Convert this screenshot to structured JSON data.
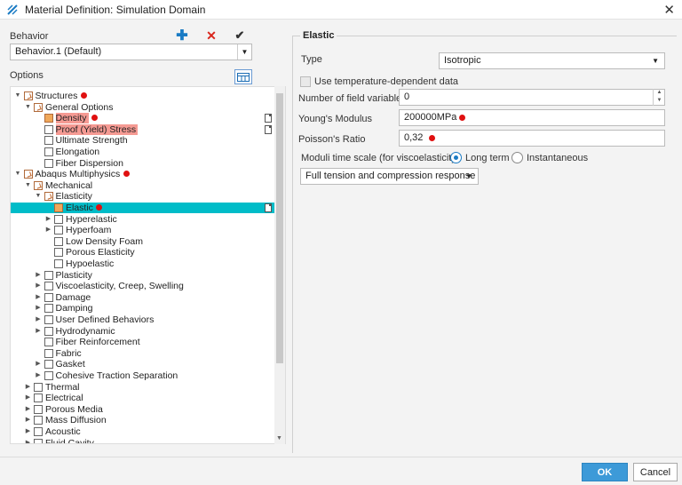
{
  "window": {
    "title": "Material Definition: Simulation Domain",
    "close_glyph": "✕"
  },
  "behavior": {
    "label": "Behavior",
    "selected": "Behavior.1 (Default)",
    "add_glyph": "✚",
    "delete_glyph": "✕",
    "confirm_glyph": "✔"
  },
  "options": {
    "label": "Options",
    "tree": [
      {
        "label": "Structures",
        "expander": "▼",
        "mod": true,
        "dot": true
      },
      {
        "label": "General Options",
        "expander": "▼",
        "mod": true
      },
      {
        "label": "Density",
        "checked": true,
        "highlight": true,
        "dot": true,
        "doc": true
      },
      {
        "label": "Proof (Yield) Stress",
        "highlight": true,
        "doc": true
      },
      {
        "label": "Ultimate Strength"
      },
      {
        "label": "Elongation"
      },
      {
        "label": "Fiber Dispersion"
      },
      {
        "label": "Abaqus Multiphysics",
        "expander": "▼",
        "mod": true,
        "dot": true
      },
      {
        "label": "Mechanical",
        "expander": "▼",
        "mod": true
      },
      {
        "label": "Elasticity",
        "expander": "▼",
        "mod": true
      },
      {
        "label": "Elastic",
        "checked": true,
        "selected": true,
        "dot": true,
        "doc": true
      },
      {
        "label": "Hyperelastic",
        "expander": "▶"
      },
      {
        "label": "Hyperfoam",
        "expander": "▶"
      },
      {
        "label": "Low Density Foam"
      },
      {
        "label": "Porous Elasticity"
      },
      {
        "label": "Hypoelastic"
      },
      {
        "label": "Plasticity",
        "expander": "▶"
      },
      {
        "label": "Viscoelasticity, Creep, Swelling",
        "expander": "▶"
      },
      {
        "label": "Damage",
        "expander": "▶"
      },
      {
        "label": "Damping",
        "expander": "▶"
      },
      {
        "label": "User Defined Behaviors",
        "expander": "▶"
      },
      {
        "label": "Hydrodynamic",
        "expander": "▶"
      },
      {
        "label": "Fiber Reinforcement"
      },
      {
        "label": "Fabric"
      },
      {
        "label": "Gasket",
        "expander": "▶"
      },
      {
        "label": "Cohesive Traction Separation",
        "expander": "▶"
      },
      {
        "label": "Thermal",
        "expander": "▶"
      },
      {
        "label": "Electrical",
        "expander": "▶"
      },
      {
        "label": "Porous Media",
        "expander": "▶"
      },
      {
        "label": "Mass Diffusion",
        "expander": "▶"
      },
      {
        "label": "Acoustic",
        "expander": "▶"
      },
      {
        "label": "Fluid Cavity",
        "expander": "▶"
      }
    ]
  },
  "elastic": {
    "title": "Elastic",
    "type_label": "Type",
    "type_value": "Isotropic",
    "temp_dependent_label": "Use temperature-dependent data",
    "field_vars_label": "Number of field variables",
    "field_vars_value": "0",
    "youngs_label": "Young's Modulus",
    "youngs_value": "200000MPa",
    "poisson_label": "Poisson's Ratio",
    "poisson_value": "0,32",
    "moduli_label": "Moduli time scale (for viscoelasticity)",
    "long_term_label": "Long term",
    "instantaneous_label": "Instantaneous",
    "response_value": "Full tension and compression response"
  },
  "buttons": {
    "ok": "OK",
    "cancel": "Cancel"
  },
  "colors": {
    "selection": "#00bcc8",
    "highlight": "#f59a93",
    "accent": "#3d9ad8",
    "marker": "#e01010"
  }
}
